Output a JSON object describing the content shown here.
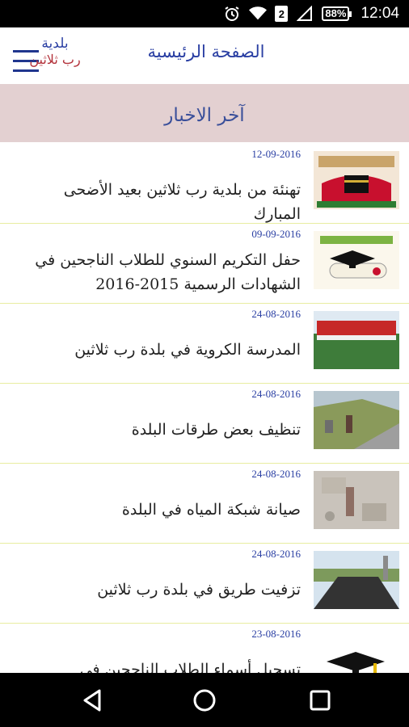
{
  "status_bar": {
    "battery": "88%",
    "sim": "2",
    "time": "12:04"
  },
  "header": {
    "title": "الصفحة الرئيسية",
    "logo_line1": "بلدية",
    "logo_line2": "رب ثلاثين"
  },
  "section": {
    "title": "آخر الاخبار"
  },
  "news": [
    {
      "date": "12-09-2016",
      "title": "تهنئة من بلدية رب ثلاثين بعيد الأضحى المبارك"
    },
    {
      "date": "09-09-2016",
      "title": "حفل التكريم السنوي للطلاب الناجحين في الشهادات الرسمية 2015-2016"
    },
    {
      "date": "24-08-2016",
      "title": "المدرسة الكروية في بلدة رب ثلاثين"
    },
    {
      "date": "24-08-2016",
      "title": "تنظيف بعض طرقات البلدة"
    },
    {
      "date": "24-08-2016",
      "title": "صيانة شبكة المياه في البلدة"
    },
    {
      "date": "24-08-2016",
      "title": "تزفيت طريق في بلدة رب ثلاثين"
    },
    {
      "date": "23-08-2016",
      "title": "تسجيل أسماء الطلاب الناجحين في الامتحانات الرسمية"
    }
  ],
  "colors": {
    "accent": "#2a3fa3",
    "section_bg": "#e3d0d1",
    "divider": "#e8eda0",
    "logo_red": "#b3323b"
  }
}
